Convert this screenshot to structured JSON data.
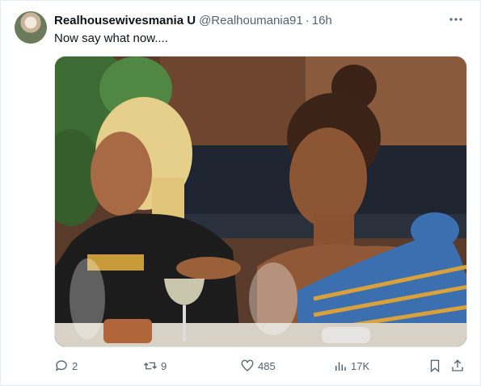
{
  "tweet": {
    "display_name": "Realhousewivesmania U",
    "handle": "@Realhoumania91",
    "separator": "·",
    "time": "16h",
    "text": "Now say what now....",
    "media_icon": "photo",
    "replies": "2",
    "retweets": "9",
    "likes": "485",
    "views": "17K"
  },
  "icons": {
    "more": "more-horizontal-icon",
    "reply": "reply-icon",
    "retweet": "retweet-icon",
    "like": "heart-icon",
    "views": "analytics-icon",
    "bookmark": "bookmark-icon",
    "share": "share-icon"
  },
  "colors": {
    "text_primary": "#0f1419",
    "text_secondary": "#536471",
    "border": "#e6ecf0"
  }
}
